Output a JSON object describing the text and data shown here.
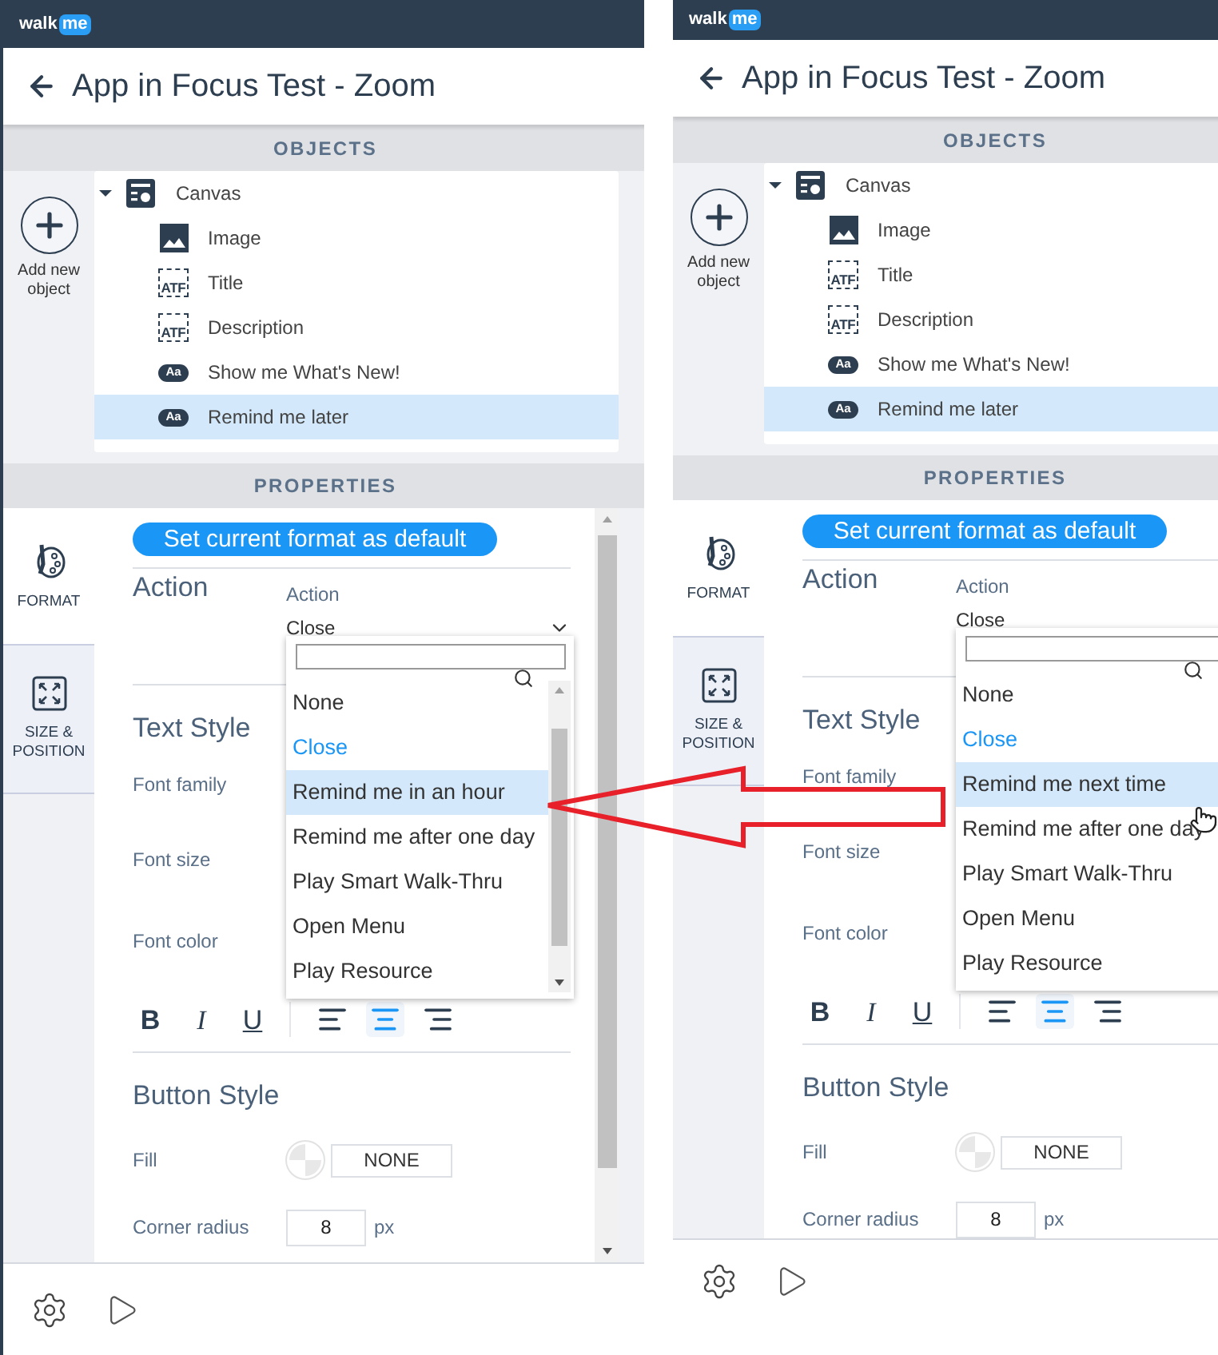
{
  "panels": [
    {
      "logo": {
        "part_1": "walk",
        "part_2": "me"
      },
      "title": "App in Focus Test - Zoom",
      "objects_header": "OBJECTS",
      "add_new_label": "Add new object",
      "tree": {
        "label": "Canvas",
        "expanded": true,
        "children": [
          {
            "label": "Image",
            "kind": "image",
            "selected": false
          },
          {
            "label": "Title",
            "kind": "text",
            "icon_text": "ATF",
            "selected": false
          },
          {
            "label": "Description",
            "kind": "text",
            "icon_text": "ATF",
            "selected": false
          },
          {
            "label": "Show me What's New!",
            "kind": "button",
            "icon_text": "Aa",
            "selected": false
          },
          {
            "label": "Remind me later",
            "kind": "button",
            "icon_text": "Aa",
            "selected": true
          }
        ]
      },
      "properties_header": "PROPERTIES",
      "tabs": [
        {
          "label": "FORMAT",
          "kind": "format",
          "selected": true
        },
        {
          "label": "SIZE & POSITION",
          "kind": "size",
          "selected": false
        }
      ],
      "default_button": "Set current format as default",
      "action": {
        "heading": "Action",
        "field_label": "Action",
        "value": "Close"
      },
      "dropdown": {
        "options": [
          {
            "label": "None",
            "selected": false,
            "hovered": false
          },
          {
            "label": "Close",
            "selected": true,
            "hovered": false
          },
          {
            "label": "Remind me in an hour",
            "selected": false,
            "hovered": true
          },
          {
            "label": "Remind me after one day",
            "selected": false,
            "hovered": false
          },
          {
            "label": "Play Smart Walk-Thru",
            "selected": false,
            "hovered": false
          },
          {
            "label": "Open Menu",
            "selected": false,
            "hovered": false
          },
          {
            "label": "Play Resource",
            "selected": false,
            "hovered": false
          }
        ]
      },
      "text_style": {
        "heading": "Text Style",
        "rows": [
          "Font family",
          "Font size",
          "Font color"
        ],
        "format_buttons": [
          "B",
          "I",
          "U"
        ],
        "alignments": [
          {
            "kind": "left",
            "selected": false
          },
          {
            "kind": "center",
            "selected": true
          },
          {
            "kind": "right",
            "selected": false
          }
        ]
      },
      "button_style": {
        "heading": "Button Style",
        "fill_label": "Fill",
        "fill_value": "NONE",
        "radius_label": "Corner radius",
        "radius_value": "8",
        "radius_unit": "px"
      }
    },
    {
      "logo": {
        "part_1": "walk",
        "part_2": "me"
      },
      "title": "App in Focus Test - Zoom",
      "objects_header": "OBJECTS",
      "add_new_label": "Add new object",
      "tree": {
        "label": "Canvas",
        "expanded": true,
        "children": [
          {
            "label": "Image",
            "kind": "image",
            "selected": false
          },
          {
            "label": "Title",
            "kind": "text",
            "icon_text": "ATF",
            "selected": false
          },
          {
            "label": "Description",
            "kind": "text",
            "icon_text": "ATF",
            "selected": false
          },
          {
            "label": "Show me What's New!",
            "kind": "button",
            "icon_text": "Aa",
            "selected": false
          },
          {
            "label": "Remind me later",
            "kind": "button",
            "icon_text": "Aa",
            "selected": true
          }
        ]
      },
      "properties_header": "PROPERTIES",
      "tabs": [
        {
          "label": "FORMAT",
          "kind": "format",
          "selected": true
        },
        {
          "label": "SIZE & POSITION",
          "kind": "size",
          "selected": false
        }
      ],
      "default_button": "Set current format as default",
      "action": {
        "heading": "Action",
        "field_label": "Action",
        "value": "Close"
      },
      "dropdown": {
        "options": [
          {
            "label": "None",
            "selected": false,
            "hovered": false
          },
          {
            "label": "Close",
            "selected": true,
            "hovered": false
          },
          {
            "label": "Remind me next time",
            "selected": false,
            "hovered": true
          },
          {
            "label": "Remind me after one day",
            "selected": false,
            "hovered": false
          },
          {
            "label": "Play Smart Walk-Thru",
            "selected": false,
            "hovered": false
          },
          {
            "label": "Open Menu",
            "selected": false,
            "hovered": false
          },
          {
            "label": "Play Resource",
            "selected": false,
            "hovered": false
          }
        ]
      },
      "text_style": {
        "heading": "Text Style",
        "rows": [
          "Font family",
          "Font size",
          "Font color"
        ],
        "format_buttons": [
          "B",
          "I",
          "U"
        ],
        "alignments": [
          {
            "kind": "left",
            "selected": false
          },
          {
            "kind": "center",
            "selected": true
          },
          {
            "kind": "right",
            "selected": false
          }
        ]
      },
      "button_style": {
        "heading": "Button Style",
        "fill_label": "Fill",
        "fill_value": "NONE",
        "radius_label": "Corner radius",
        "radius_value": "8",
        "radius_unit": "px"
      }
    }
  ]
}
